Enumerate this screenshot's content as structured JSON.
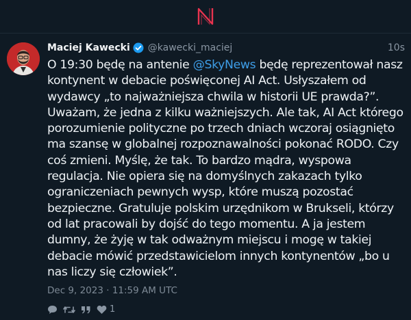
{
  "app": {
    "logo_letter": "N"
  },
  "tweet": {
    "author_name": "Maciej Kawecki",
    "handle": "@kawecki_maciej",
    "time_ago": "10s",
    "text_before_mention": "O 19:30 będę na antenie ",
    "mention": "@SkyNews",
    "text_after_mention": " będę reprezentował nasz kontynent w debacie poświęconej AI Act. Usłyszałem od wydawcy „to najważniejsza chwila w historii UE prawda?”. Uważam, że jedna z kilku ważniejszych. Ale tak, AI Act którego porozumienie polityczne po trzech dniach wczoraj osiągnięto ma szansę w globalnej rozpoznawalności pokonać RODO. Czy coś zmieni. Myślę, że tak. To bardzo mądra, wyspowa regulacja. Nie opiera się na domyślnych zakazach tylko ograniczeniach pewnych wysp, które muszą pozostać bezpieczne. Gratuluje polskim urzędnikom w Brukseli, którzy od lat pracowali by dojść do tego momentu. A ja jestem dumny, że żyję w tak odważnym miejscu i mogę w takiej debacie mówić przedstawicielom innych kontynentów „bo u nas liczy się człowiek”.",
    "date": "Dec 9, 2023 · 11:59 AM UTC",
    "like_count": "1"
  },
  "colors": {
    "background": "#0f1a24",
    "mention": "#3e9ee8",
    "logo": "#e8334f",
    "verified": "#1d9bf0"
  },
  "icons": [
    "reply-icon",
    "retweet-icon",
    "quote-icon",
    "like-icon",
    "verified-icon"
  ]
}
